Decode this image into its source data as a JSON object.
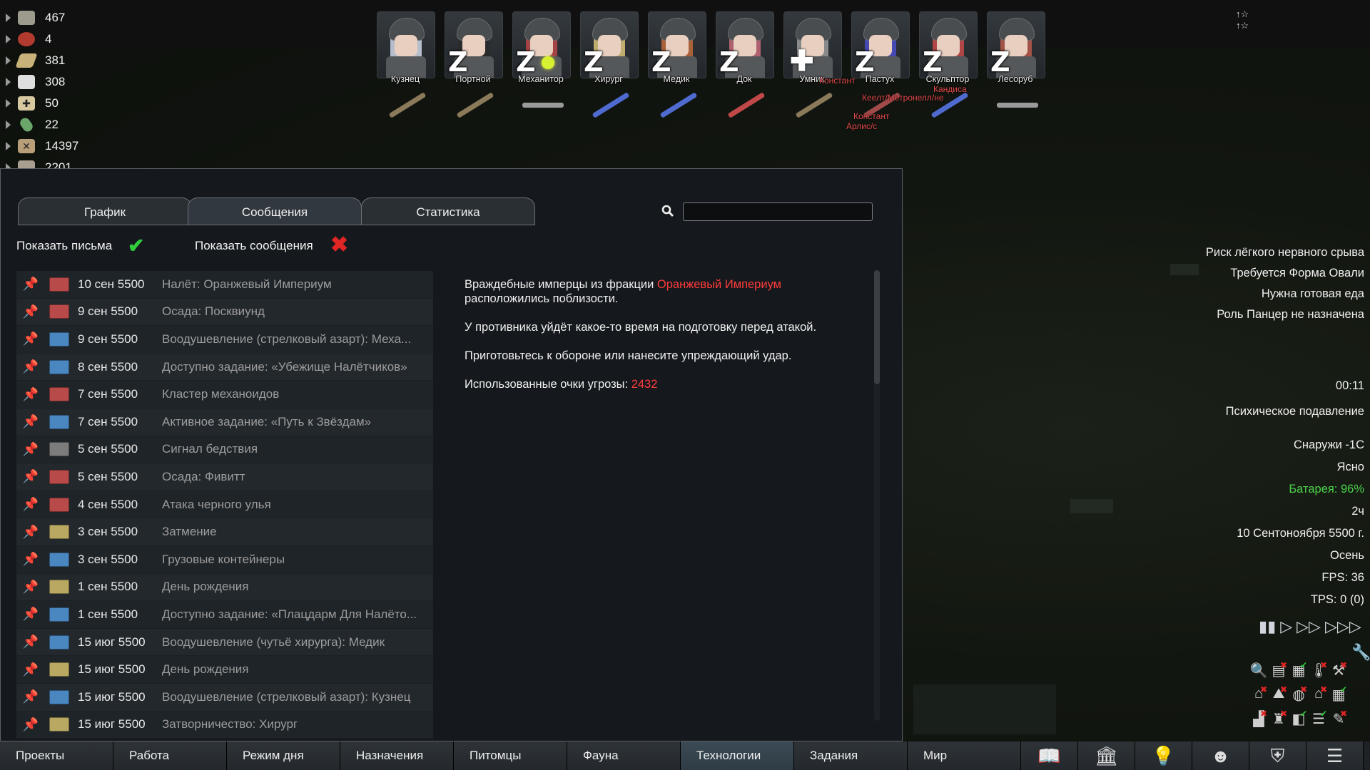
{
  "resources": [
    {
      "icon": "silver-icon",
      "value": "467",
      "color": "#9d9a8e"
    },
    {
      "icon": "berries-icon",
      "value": "4",
      "color": "#b23a2e"
    },
    {
      "icon": "wood-icon",
      "value": "381",
      "color": "#c9b27a"
    },
    {
      "icon": "cloth-icon",
      "value": "308",
      "color": "#dedede"
    },
    {
      "icon": "medicine-icon",
      "value": "50",
      "color": "#d8c8a0"
    },
    {
      "icon": "pill-icon",
      "value": "22",
      "color": "#6aa66a"
    },
    {
      "icon": "leather-icon",
      "value": "14397",
      "color": "#b89f7a"
    },
    {
      "icon": "stone-icon",
      "value": "2201",
      "color": "#a89f90"
    }
  ],
  "colonists": [
    {
      "name": "Кузнец",
      "state": "",
      "hair": "#cfd6e8"
    },
    {
      "name": "Портной",
      "state": "Z",
      "hair": "#2a2a2a"
    },
    {
      "name": "Механитор",
      "state": "Z",
      "hair": "#b84646"
    },
    {
      "name": "Хирург",
      "state": "Z",
      "hair": "#d9c37a"
    },
    {
      "name": "Медик",
      "state": "Z",
      "hair": "#c06a3a"
    },
    {
      "name": "Док",
      "state": "Z",
      "hair": "#c86a7a"
    },
    {
      "name": "Умник",
      "state": "+",
      "hair": "#9a9a9a"
    },
    {
      "name": "Пастух",
      "state": "Z",
      "hair": "#4a4ec8"
    },
    {
      "name": "Скульптор",
      "state": "Z",
      "hair": "#c84a4a"
    },
    {
      "name": "Лесоруб",
      "state": "Z",
      "hair": "#b8584a"
    }
  ],
  "weapon_colors": [
    "#8a7a5a",
    "#8a7a5a",
    "#9a9a9a",
    "#4f6bd0",
    "#4f6bd0",
    "#c04848",
    "#8a7a5a",
    "#a04a4a",
    "#4f6bd0",
    "#9a9a9a"
  ],
  "floating": {
    "label1": "Констант",
    "label2": "Кеелт/Метронелл/не",
    "label3": "Кандиса",
    "label4": "Констант",
    "label5": "Арлис/с"
  },
  "tabs": [
    "График",
    "Сообщения",
    "Статистика"
  ],
  "toggles": {
    "letters": "Показать письма",
    "messages": "Показать сообщения"
  },
  "messages": [
    {
      "date": "10 сен 5500",
      "title": "Налёт: Оранжевый Империум",
      "color": "#b84a4a"
    },
    {
      "date": "9 сен 5500",
      "title": "Осада: Посквиунд",
      "color": "#b84a4a"
    },
    {
      "date": "9 сен 5500",
      "title": "Воодушевление (стрелковый азарт): Меха...",
      "color": "#4a86c0"
    },
    {
      "date": "8 сен 5500",
      "title": "Доступно задание: «Убежище Налётчиков»",
      "color": "#4a86c0"
    },
    {
      "date": "7 сен 5500",
      "title": "Кластер механоидов",
      "color": "#b84a4a"
    },
    {
      "date": "7 сен 5500",
      "title": "Активное задание: «Путь к Звёздам»",
      "color": "#4a86c0"
    },
    {
      "date": "5 сен 5500",
      "title": "Сигнал бедствия",
      "color": "#7c7c7c"
    },
    {
      "date": "5 сен 5500",
      "title": "Осада: Фивитт",
      "color": "#b84a4a"
    },
    {
      "date": "4 сен 5500",
      "title": "Атака черного улья",
      "color": "#b84a4a"
    },
    {
      "date": "3 сен 5500",
      "title": "Затмение",
      "color": "#b8a862"
    },
    {
      "date": "3 сен 5500",
      "title": "Грузовые контейнеры",
      "color": "#4a86c0"
    },
    {
      "date": "1 сен 5500",
      "title": "День рождения",
      "color": "#b8a862"
    },
    {
      "date": "1 сен 5500",
      "title": "Доступно задание: «Плацдарм Для Налёто...",
      "color": "#4a86c0"
    },
    {
      "date": "15 июг 5500",
      "title": "Воодушевление (чутьё хирурга): Медик",
      "color": "#4a86c0"
    },
    {
      "date": "15 июг 5500",
      "title": "День рождения",
      "color": "#b8a862"
    },
    {
      "date": "15 июг 5500",
      "title": "Воодушевление (стрелковый азарт): Кузнец",
      "color": "#4a86c0"
    },
    {
      "date": "15 июг 5500",
      "title": "Затворничество: Хирург",
      "color": "#b8a862"
    }
  ],
  "body": {
    "p1_pre": "Враждебные имперцы из фракции ",
    "p1_faction": "Оранжевый Империум",
    "p1_post": "расположились поблизости.",
    "p2": "У противника уйдёт какое-то время на подготовку перед атакой.",
    "p3": "Приготовьтесь к обороне или нанесите упреждающий удар.",
    "p4_pre": "Использованные очки угрозы: ",
    "p4_value": "2432"
  },
  "alerts": [
    "Риск лёгкого нервного срыва",
    "Требуется Форма Овали",
    "Нужна готовая еда",
    "Роль Панцер не назначена"
  ],
  "info": {
    "time": "00:11",
    "condition": "Психическое подавление",
    "temp": "Снаружи -1С",
    "weather": "Ясно",
    "battery": "Батарея: 96%",
    "hour": "2ч",
    "date": "10 Сентоноября 5500 г.",
    "season": "Осень",
    "fps": "FPS: 36",
    "tps": "TPS: 0 (0)"
  },
  "bottom_tabs": [
    "Проекты",
    "Работа",
    "Режим дня",
    "Назначения",
    "Питомцы",
    "Фауна",
    "Технологии",
    "Задания",
    "Мир"
  ],
  "bottom_icons": [
    "book-icon",
    "factions-icon",
    "lightbulb-icon",
    "head-icon",
    "armor-icon",
    "menu-icon"
  ],
  "colors": {
    "accent_red": "#ff3b3b",
    "check_green": "#2fcc3c",
    "battery_green": "#4bd24b"
  }
}
